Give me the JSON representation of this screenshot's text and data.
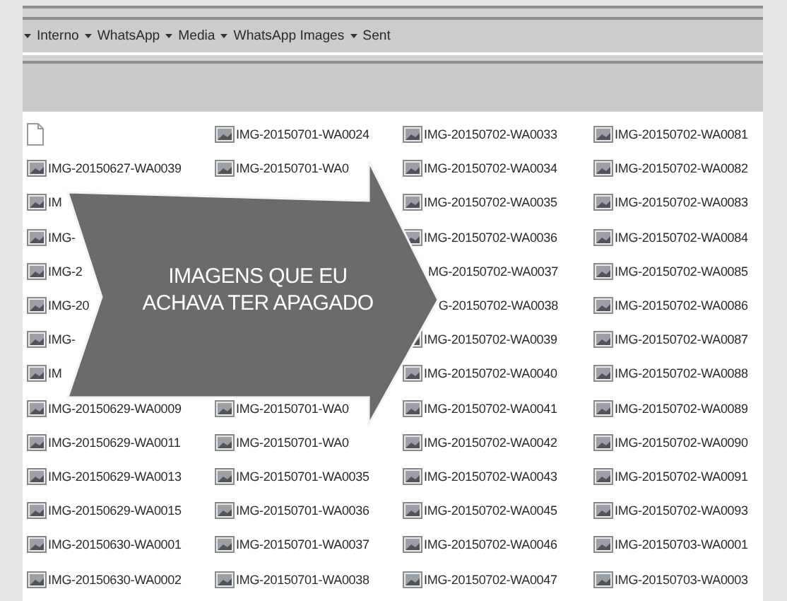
{
  "breadcrumb": [
    "Interno",
    "WhatsApp",
    "Media",
    "WhatsApp Images",
    "Sent"
  ],
  "files": [
    {
      "kind": "blank-file"
    },
    {
      "kind": "file",
      "name": "IMG-20150701-WA0024"
    },
    {
      "kind": "file",
      "name": "IMG-20150702-WA0033"
    },
    {
      "kind": "file",
      "name": "IMG-20150702-WA0081"
    },
    {
      "kind": "file",
      "name": "IMG-20150627-WA0039"
    },
    {
      "kind": "file",
      "name": "IMG-20150701-WA0"
    },
    {
      "kind": "file",
      "name": "IMG-20150702-WA0034"
    },
    {
      "kind": "file",
      "name": "IMG-20150702-WA0082"
    },
    {
      "kind": "file",
      "name": "IM"
    },
    {
      "kind": "covered"
    },
    {
      "kind": "file",
      "name": "IMG-20150702-WA0035"
    },
    {
      "kind": "file",
      "name": "IMG-20150702-WA0083"
    },
    {
      "kind": "file",
      "name": "IMG-"
    },
    {
      "kind": "covered"
    },
    {
      "kind": "file",
      "name": "IMG-20150702-WA0036"
    },
    {
      "kind": "file",
      "name": "IMG-20150702-WA0084"
    },
    {
      "kind": "file",
      "name": "IMG-2"
    },
    {
      "kind": "covered"
    },
    {
      "kind": "tail",
      "name": "MG-20150702-WA0037"
    },
    {
      "kind": "file",
      "name": "IMG-20150702-WA0085"
    },
    {
      "kind": "file",
      "name": "IMG-20"
    },
    {
      "kind": "covered"
    },
    {
      "kind": "tail",
      "name": "G-20150702-WA0038"
    },
    {
      "kind": "file",
      "name": "IMG-20150702-WA0086"
    },
    {
      "kind": "file",
      "name": "IMG-"
    },
    {
      "kind": "covered"
    },
    {
      "kind": "file",
      "name": "IMG-20150702-WA0039"
    },
    {
      "kind": "file",
      "name": "IMG-20150702-WA0087"
    },
    {
      "kind": "file",
      "name": "IM"
    },
    {
      "kind": "covered"
    },
    {
      "kind": "file",
      "name": "IMG-20150702-WA0040"
    },
    {
      "kind": "file",
      "name": "IMG-20150702-WA0088"
    },
    {
      "kind": "file",
      "name": "IMG-20150629-WA0009"
    },
    {
      "kind": "file",
      "name": "IMG-20150701-WA0"
    },
    {
      "kind": "file",
      "name": "IMG-20150702-WA0041"
    },
    {
      "kind": "file",
      "name": "IMG-20150702-WA0089"
    },
    {
      "kind": "file",
      "name": "IMG-20150629-WA0011"
    },
    {
      "kind": "file",
      "name": "IMG-20150701-WA0"
    },
    {
      "kind": "file",
      "name": "IMG-20150702-WA0042"
    },
    {
      "kind": "file",
      "name": "IMG-20150702-WA0090"
    },
    {
      "kind": "file",
      "name": "IMG-20150629-WA0013"
    },
    {
      "kind": "file",
      "name": "IMG-20150701-WA0035"
    },
    {
      "kind": "file",
      "name": "IMG-20150702-WA0043"
    },
    {
      "kind": "file",
      "name": "IMG-20150702-WA0091"
    },
    {
      "kind": "file",
      "name": "IMG-20150629-WA0015"
    },
    {
      "kind": "file",
      "name": "IMG-20150701-WA0036"
    },
    {
      "kind": "file",
      "name": "IMG-20150702-WA0045"
    },
    {
      "kind": "file",
      "name": "IMG-20150702-WA0093"
    },
    {
      "kind": "file",
      "name": "IMG-20150630-WA0001"
    },
    {
      "kind": "file",
      "name": "IMG-20150701-WA0037"
    },
    {
      "kind": "file",
      "name": "IMG-20150702-WA0046"
    },
    {
      "kind": "file",
      "name": "IMG-20150703-WA0001"
    },
    {
      "kind": "file",
      "name": "IMG-20150630-WA0002"
    },
    {
      "kind": "file",
      "name": "IMG-20150701-WA0038"
    },
    {
      "kind": "file",
      "name": "IMG-20150702-WA0047"
    },
    {
      "kind": "file",
      "name": "IMG-20150703-WA0003"
    }
  ],
  "callout": {
    "lines": [
      "IMAGENS QUE EU",
      "ACHAVA TER APAGADO"
    ]
  }
}
